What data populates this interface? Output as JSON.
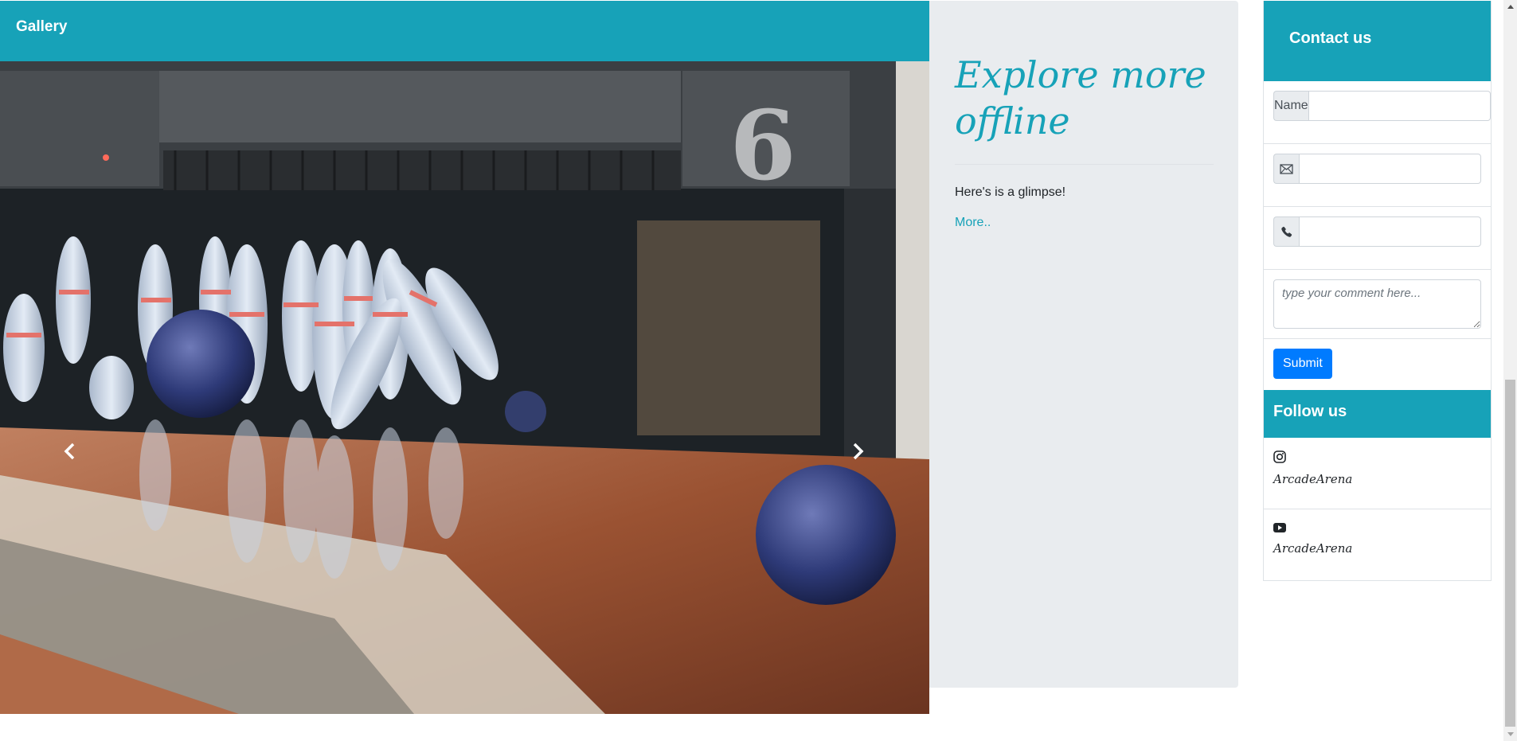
{
  "gallery": {
    "title": "Gallery",
    "image_subject": "bowling-pins-lane-6-photo",
    "lane_number": "6",
    "prev_icon": "chevron-left-icon",
    "next_icon": "chevron-right-icon"
  },
  "explore": {
    "title": "Explore more offline",
    "text": "Here's is a glimpse!",
    "link": "More.."
  },
  "contact": {
    "title": "Contact us",
    "name_label": "Name",
    "name_value": "",
    "email_icon": "envelope-icon",
    "email_value": "",
    "phone_icon": "phone-icon",
    "phone_value": "",
    "comment_placeholder": "type your comment here...",
    "submit_label": "Submit"
  },
  "follow": {
    "title": "Follow us",
    "items": [
      {
        "icon": "instagram-icon",
        "handle": "ArcadeArena"
      },
      {
        "icon": "youtube-icon",
        "handle": "ArcadeArena"
      }
    ]
  },
  "colors": {
    "accent": "#17a2b8",
    "primary_button": "#007bff",
    "panel_bg": "#e9ecef"
  }
}
